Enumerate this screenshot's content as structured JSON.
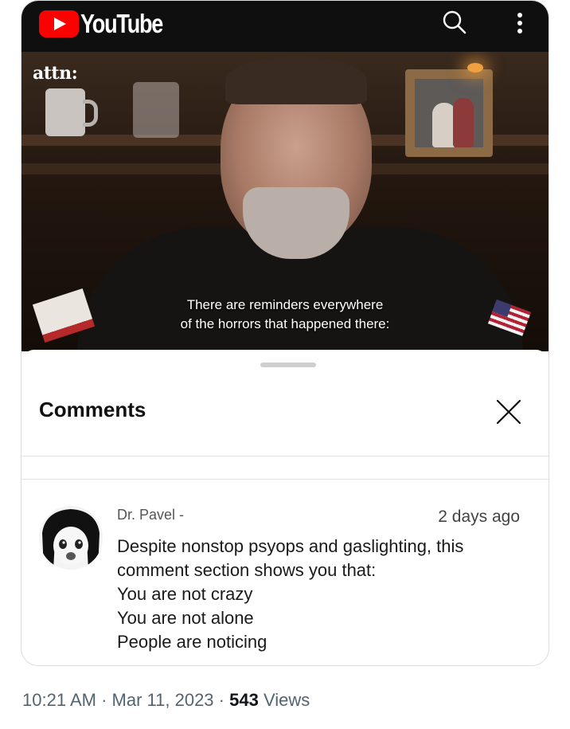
{
  "youtube": {
    "wordmark": "YouTube"
  },
  "video": {
    "channel_logo": "attn:",
    "subtitle_lines": [
      "There are reminders everywhere",
      "of the horrors that happened there:"
    ]
  },
  "comments_sheet": {
    "title": "Comments",
    "comment": {
      "author": "Dr. Pavel -",
      "time": "2 days ago",
      "lines": [
        "Despite nonstop psyops and gaslighting, this",
        "comment section shows you that:",
        "You are not crazy",
        "You are not alone",
        "People are noticing"
      ]
    }
  },
  "tweet_meta": {
    "time": "10:21 AM",
    "dot1": "·",
    "date": "Mar 11, 2023",
    "dot2": "·",
    "views_count": "543",
    "views_label": "Views"
  },
  "icons": {
    "search": "search-icon",
    "more": "more-vertical-icon",
    "close": "close-icon",
    "play": "youtube-play-icon"
  },
  "colors": {
    "youtube_red": "#ff0000",
    "topbar": "#0f0f0f",
    "meta_text": "#536471"
  }
}
